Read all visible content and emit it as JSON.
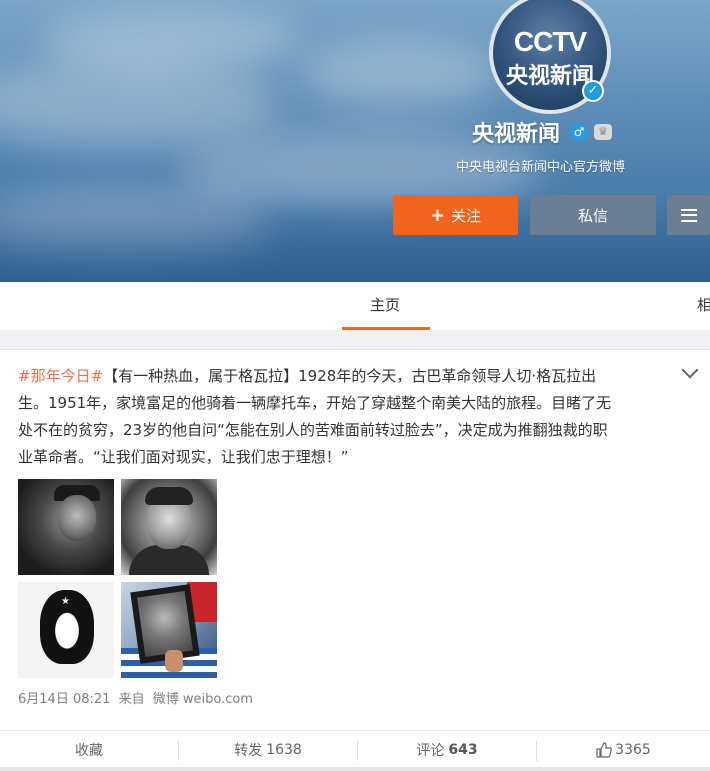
{
  "profile": {
    "avatar_logo_en": "CCTV",
    "avatar_logo_cn": "央视新闻",
    "name": "央视新闻",
    "gender_symbol": "♂",
    "bio": "中央电视台新闻中心官方微博",
    "follow_label": "关注",
    "message_label": "私信",
    "brand_color": "#f0641e",
    "secondary_button_color": "#6b7e93"
  },
  "tabs": {
    "home": "主页",
    "next_partial": "相"
  },
  "post": {
    "hashtag": "#那年今日#",
    "lines": [
      "【有一种热血，属于格瓦拉】1928年的今天，古巴革命领导人切·格瓦拉出",
      "生。1951年，家境富足的他骑着一辆摩托车，开始了穿越整个南美大陆的旅程。目睹了无",
      "处不在的贫穷，23岁的他自问“怎能在别人的苦难面前转过脸去”，决定成为推翻独裁的职",
      "业革命者。“让我们面对现实，让我们忠于理想！”"
    ],
    "meta": {
      "time": "6月14日 08:21",
      "from_label": "来自",
      "source": "微博 weibo.com"
    },
    "actions": {
      "favorite_label": "收藏",
      "repost_label": "转发",
      "repost_count": "1638",
      "comment_label": "评论",
      "comment_count": "643",
      "like_count": "3365"
    }
  }
}
